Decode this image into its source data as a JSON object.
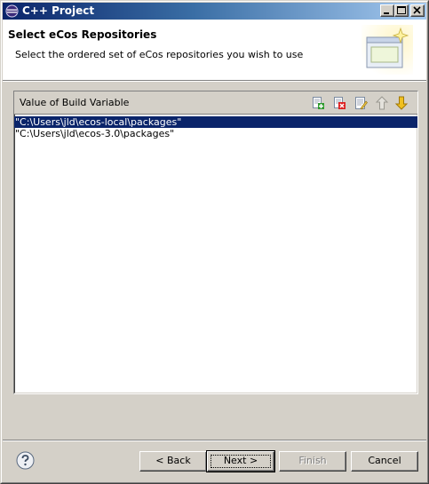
{
  "window": {
    "title": "C++ Project"
  },
  "banner": {
    "title": "Select eCos Repositories",
    "description": "Select the ordered set of eCos repositories you wish to use"
  },
  "table": {
    "column_header": "Value of Build Variable",
    "toolbar_icons": [
      "add-icon",
      "delete-icon",
      "edit-icon",
      "move-up-icon",
      "move-down-icon"
    ],
    "rows": [
      {
        "value": "\"C:\\Users\\jld\\ecos-local\\packages\"",
        "selected": true
      },
      {
        "value": "\"C:\\Users\\jld\\ecos-3.0\\packages\"",
        "selected": false
      }
    ]
  },
  "buttons": {
    "back": "< Back",
    "next": "Next >",
    "finish": "Finish",
    "cancel": "Cancel"
  },
  "colors": {
    "selection": "#0a246a",
    "dialog_bg": "#d4d0c8"
  }
}
